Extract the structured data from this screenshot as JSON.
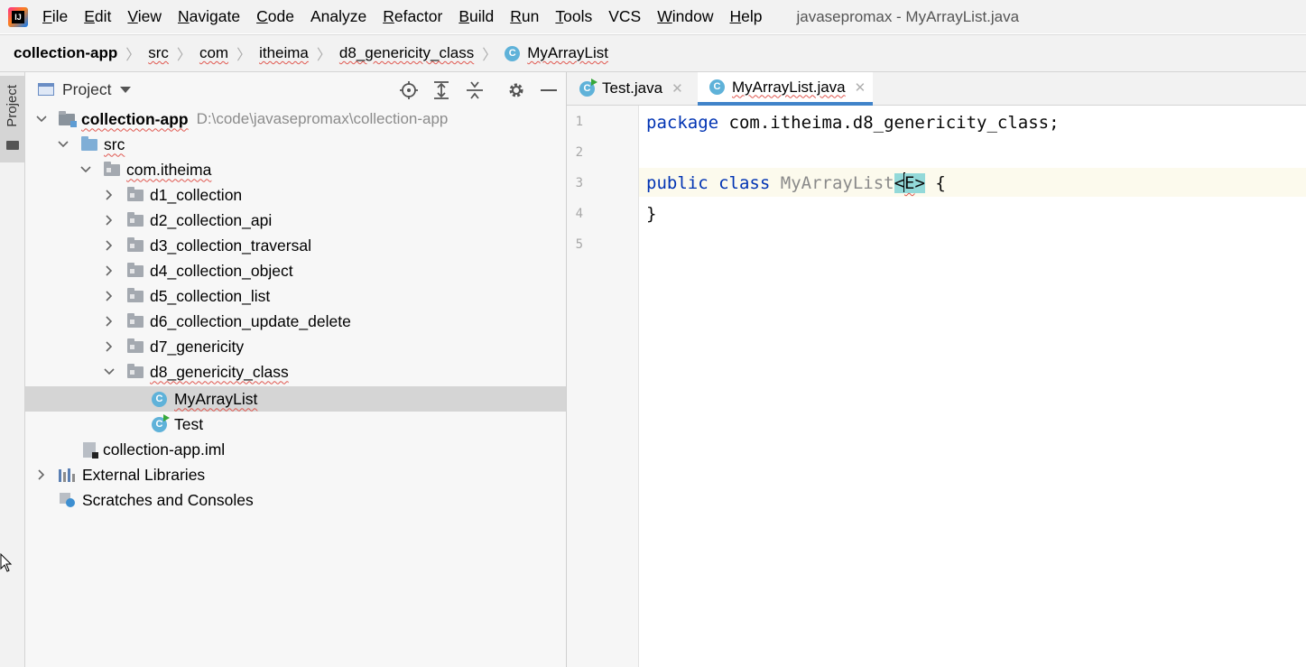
{
  "menubar": {
    "logo_text": "IJ",
    "items": [
      {
        "mnemonic": "F",
        "rest": "ile"
      },
      {
        "mnemonic": "E",
        "rest": "dit"
      },
      {
        "mnemonic": "V",
        "rest": "iew"
      },
      {
        "mnemonic": "N",
        "rest": "avigate"
      },
      {
        "mnemonic": "C",
        "rest": "ode"
      },
      {
        "mnemonic": "",
        "rest": "Analyze"
      },
      {
        "mnemonic": "R",
        "rest": "efactor"
      },
      {
        "mnemonic": "B",
        "rest": "uild"
      },
      {
        "mnemonic": "R",
        "rest": "un"
      },
      {
        "mnemonic": "T",
        "rest": "ools"
      },
      {
        "mnemonic": "",
        "rest": "VCS"
      },
      {
        "mnemonic": "W",
        "rest": "indow"
      },
      {
        "mnemonic": "H",
        "rest": "elp"
      }
    ],
    "window_title": "javasepromax - MyArrayList.java"
  },
  "breadcrumb": {
    "items": [
      "collection-app",
      "src",
      "com",
      "itheima",
      "d8_genericity_class"
    ],
    "current": "MyArrayList",
    "class_badge": "C"
  },
  "left_strip": {
    "project_label": "Project"
  },
  "project_panel": {
    "title": "Project",
    "tools": [
      "locate-icon",
      "expand-all-icon",
      "collapse-all-icon",
      "gear-icon",
      "hide-icon"
    ],
    "tree": {
      "root_name": "collection-app",
      "root_path": "D:\\code\\javasepromax\\collection-app",
      "src": "src",
      "package": "com.itheima",
      "folders": [
        "d1_collection",
        "d2_collection_api",
        "d3_collection_traversal",
        "d4_collection_object",
        "d5_collection_list",
        "d6_collection_update_delete",
        "d7_genericity",
        "d8_genericity_class"
      ],
      "class_files": [
        "MyArrayList",
        "Test"
      ],
      "iml_file": "collection-app.iml",
      "external_libraries": "External Libraries",
      "scratches": "Scratches and Consoles"
    }
  },
  "editor": {
    "tabs": [
      {
        "label": "Test.java",
        "active": false
      },
      {
        "label": "MyArrayList.java",
        "active": true
      }
    ],
    "line_numbers": [
      "1",
      "2",
      "3",
      "4",
      "5"
    ],
    "code": {
      "line1_kw": "package",
      "line1_rest": " com.itheima.d8_genericity_class;",
      "line3_kw1": "public",
      "line3_kw2": "class",
      "line3_class": "MyArrayList",
      "line3_lt": "<",
      "line3_param": "E",
      "line3_gt": ">",
      "line3_brace": " {",
      "line4": "}"
    }
  },
  "colors": {
    "keyword": "#0033b3",
    "active_tab_underline": "#4083c9",
    "class_badge": "#5fb2d9",
    "selection_row": "#d5d5d5"
  }
}
